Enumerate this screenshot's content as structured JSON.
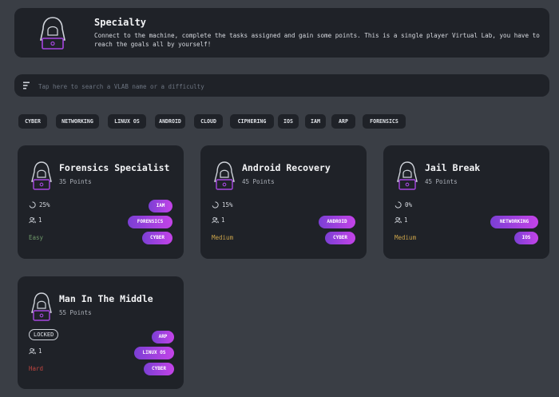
{
  "header": {
    "title": "Specialty",
    "description": "Connect to the machine, complete the tasks assigned and gain some points. This is a single player Virtual Lab, you have to reach the goals all by yourself!"
  },
  "search": {
    "placeholder": "Tap here to search a VLAB name or a difficulty"
  },
  "filters": [
    "CYBER",
    "NETWORKING",
    "LINUX OS",
    "ANDROID",
    "CLOUD",
    "CIPHERING",
    "IOS",
    "IAM",
    "ARP",
    "FORENSICS"
  ],
  "colors": {
    "accent": "#a646e0",
    "easy": "#6f9a6a",
    "medium": "#c9a24a",
    "hard": "#c0453f",
    "background": "#3a3e45",
    "card": "#1f2228"
  },
  "cards": [
    {
      "title": "Forensics Specialist",
      "points": "35 Points",
      "progress": "25%",
      "users": "1",
      "difficulty": "Easy",
      "tags": [
        "IAM",
        "FORENSICS",
        "CYBER"
      ],
      "icon": "hacker-icon"
    },
    {
      "title": "Android Recovery",
      "points": "45 Points",
      "progress": "15%",
      "users": "1",
      "difficulty": "Medium",
      "tags": [
        "ANDROID",
        "CYBER"
      ],
      "icon": "hacker-icon"
    },
    {
      "title": "Jail Break",
      "points": "45 Points",
      "progress": "0%",
      "users": "1",
      "difficulty": "Medium",
      "tags": [
        "NETWORKING",
        "IOS"
      ],
      "icon": "hacker-icon"
    },
    {
      "title": "Man In The Middle",
      "points": "55 Points",
      "status": "LOCKED",
      "users": "1",
      "difficulty": "Hard",
      "tags": [
        "ARP",
        "LINUX OS",
        "CYBER"
      ],
      "icon": "hacker-icon"
    }
  ]
}
